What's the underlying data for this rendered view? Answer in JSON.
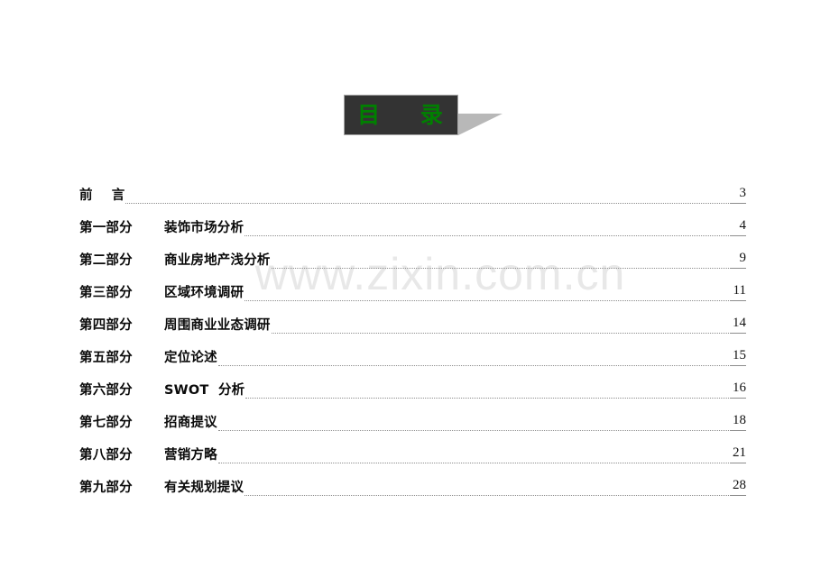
{
  "document": {
    "title_banner": {
      "text": "目    录",
      "text_color": "#008000",
      "box_color": "#333333",
      "shadow_color": "#b8b8b8"
    },
    "watermark": {
      "text": "www.zixin.com.cn",
      "color": "#e8e8e8"
    },
    "toc": {
      "entries": [
        {
          "section": "前    言",
          "title": "",
          "page": "3"
        },
        {
          "section": "第一部分",
          "title": "装饰市场分析",
          "page": "4"
        },
        {
          "section": "第二部分",
          "title": "商业房地产浅分析",
          "page": "9"
        },
        {
          "section": "第三部分",
          "title": "区域环境调研",
          "page": "11"
        },
        {
          "section": "第四部分",
          "title": "周围商业业态调研",
          "page": "14"
        },
        {
          "section": "第五部分",
          "title": "定位论述",
          "page": "15"
        },
        {
          "section": "第六部分",
          "title": "SWOT  分析",
          "page": "16"
        },
        {
          "section": "第七部分",
          "title": "招商提议",
          "page": "18"
        },
        {
          "section": "第八部分",
          "title": "营销方略",
          "page": "21"
        },
        {
          "section": "第九部分",
          "title": "有关规划提议",
          "page": "28"
        }
      ]
    }
  }
}
